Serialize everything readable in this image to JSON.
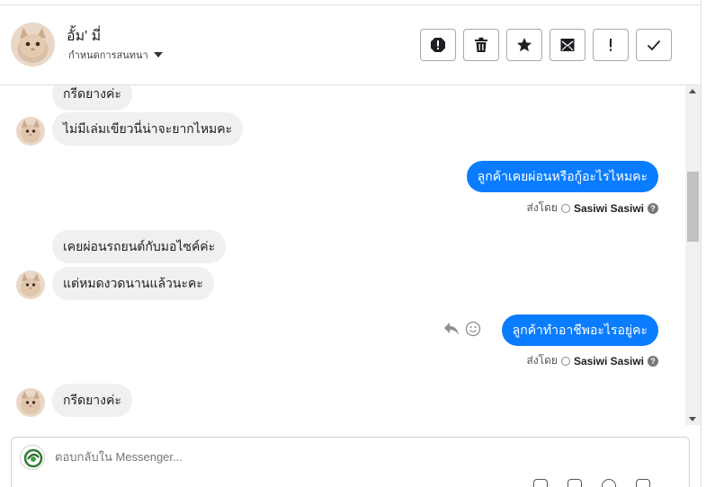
{
  "header": {
    "contact_name": "อั้ม' มี่",
    "assign_label": "กำหนดการสนทนา",
    "actions": [
      {
        "name": "report-spam-button",
        "icon": "alert-circle-icon"
      },
      {
        "name": "delete-button",
        "icon": "trash-icon"
      },
      {
        "name": "star-button",
        "icon": "star-icon"
      },
      {
        "name": "mark-unread-button",
        "icon": "envelope-icon"
      },
      {
        "name": "follow-up-button",
        "icon": "exclamation-icon"
      },
      {
        "name": "mark-done-button",
        "icon": "check-icon"
      }
    ]
  },
  "messages": [
    {
      "side": "in",
      "text": "กรีดยางค่ะ",
      "avatar": false
    },
    {
      "side": "in",
      "text": "ไม่มีเล่มเขียวนี่น่าจะยากไหมคะ",
      "avatar": true
    },
    {
      "side": "out",
      "text": "ลูกค้าเคยผ่อนหรือกู้อะไรไหมคะ"
    },
    {
      "side": "in",
      "text": "เคยผ่อนรถยนต์กับมอไซค์ค่ะ",
      "avatar": false
    },
    {
      "side": "in",
      "text": "แต่หมดงวดนานแล้วนะคะ",
      "avatar": true
    },
    {
      "side": "out",
      "text": "ลูกค้าทำอาชีพอะไรอยู่คะ"
    },
    {
      "side": "in",
      "text": "กรีดยางค่ะ",
      "avatar": true
    }
  ],
  "sent_by": {
    "prefix": "ส่งโดย",
    "sender": "Sasiwi Sasiwi",
    "help": "?"
  },
  "composer": {
    "placeholder": "ตอบกลับใน Messenger..."
  },
  "colors": {
    "outgoing_bubble": "#0a7cff",
    "incoming_bubble": "#f0f0f0"
  }
}
